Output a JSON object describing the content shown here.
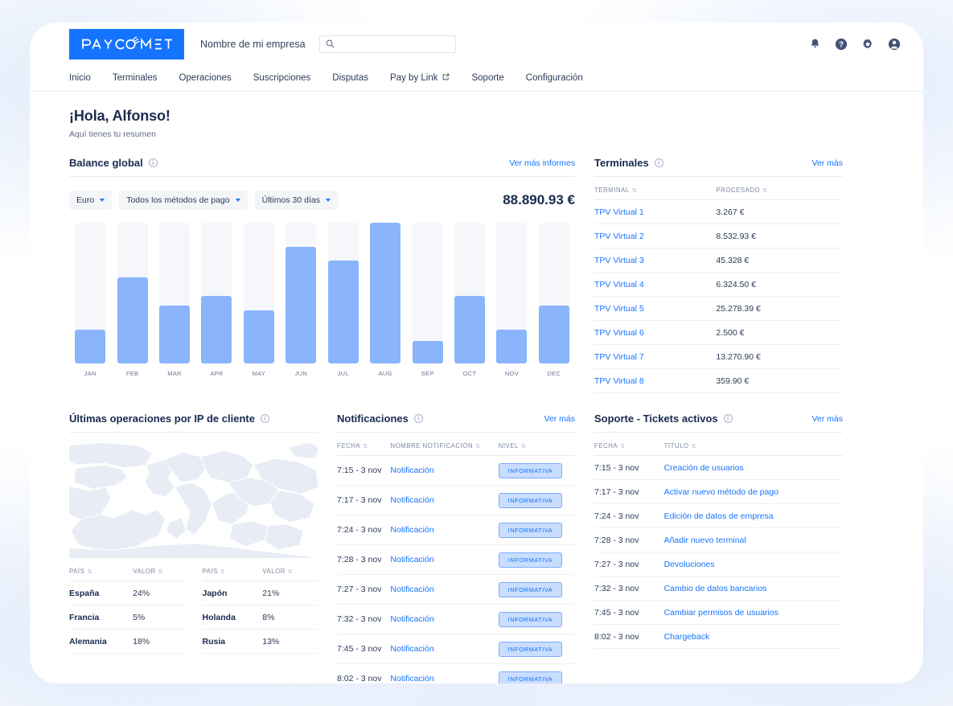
{
  "header": {
    "logo_text": "PAYCOMET",
    "company_name": "Nombre de mi empresa",
    "search_placeholder": "",
    "search_value": "",
    "icons": [
      "bell-icon",
      "help-icon",
      "gear-icon",
      "account-icon"
    ]
  },
  "nav": {
    "items": [
      {
        "label": "Inicio",
        "external": false
      },
      {
        "label": "Terminales",
        "external": false
      },
      {
        "label": "Operaciones",
        "external": false
      },
      {
        "label": "Suscripciones",
        "external": false
      },
      {
        "label": "Disputas",
        "external": false
      },
      {
        "label": "Pay by Link",
        "external": true
      },
      {
        "label": "Soporte",
        "external": false
      },
      {
        "label": "Configuración",
        "external": false
      }
    ]
  },
  "greeting": {
    "title": "¡Hola, Alfonso!",
    "subtitle": "Aquí tienes tu resumen"
  },
  "balance": {
    "title": "Balance global",
    "link": "Ver más informes",
    "filters": [
      {
        "label": "Euro"
      },
      {
        "label": "Todos los métodos de pago"
      },
      {
        "label": "Últimos 30 días"
      }
    ],
    "total": "88.890.93 €"
  },
  "chart_data": {
    "type": "bar",
    "title": "Balance global",
    "categories": [
      "JAN",
      "FEB",
      "MAR",
      "APR",
      "MAY",
      "JUN",
      "JUL",
      "AUG",
      "SEP",
      "OCT",
      "NOV",
      "DEC"
    ],
    "values": [
      24,
      61,
      41,
      48,
      38,
      83,
      73,
      100,
      16,
      48,
      24,
      41
    ],
    "xlabel": "",
    "ylabel": "",
    "ylim": [
      0,
      100
    ],
    "grid": false,
    "legend": "none",
    "bar_color": "#8ab4fc",
    "track_color": "#f5f7fa",
    "total_label": "88.890.93 €"
  },
  "terminals": {
    "title": "Terminales",
    "link": "Ver más",
    "columns": [
      "TERMINAL",
      "PROCESADO"
    ],
    "rows": [
      {
        "terminal": "TPV Virtual 1",
        "procesado": "3.267 €"
      },
      {
        "terminal": "TPV Virtual 2",
        "procesado": "8.532.93 €"
      },
      {
        "terminal": "TPV Virtual 3",
        "procesado": "45.328 €"
      },
      {
        "terminal": "TPV Virtual 4",
        "procesado": "6.324.50 €"
      },
      {
        "terminal": "TPV Virtual 5",
        "procesado": "25.278.39 €"
      },
      {
        "terminal": "TPV Virtual 6",
        "procesado": "2.500 €"
      },
      {
        "terminal": "TPV Virtual 7",
        "procesado": "13.270.90 €"
      },
      {
        "terminal": "TPV Virtual 8",
        "procesado": "359.90 €"
      }
    ]
  },
  "map_card": {
    "title": "Últimas operaciones por IP de cliente",
    "columns": [
      "PAÍS",
      "VALOR"
    ],
    "left_rows": [
      {
        "country": "España",
        "value": "24%"
      },
      {
        "country": "Francia",
        "value": "5%"
      },
      {
        "country": "Alemania",
        "value": "18%"
      }
    ],
    "right_rows": [
      {
        "country": "Japón",
        "value": "21%"
      },
      {
        "country": "Holanda",
        "value": "8%"
      },
      {
        "country": "Rusia",
        "value": "13%"
      }
    ]
  },
  "notifications": {
    "title": "Notificaciones",
    "link": "Ver más",
    "columns": [
      "FECHA",
      "NOMBRE NOTIFICACIÓN",
      "NIVEL"
    ],
    "rows": [
      {
        "fecha": "7:15 - 3 nov",
        "nombre": "Notificación",
        "nivel": "INFORMATIVA"
      },
      {
        "fecha": "7:17 - 3 nov",
        "nombre": "Notificación",
        "nivel": "INFORMATIVA"
      },
      {
        "fecha": "7:24 - 3 nov",
        "nombre": "Notificación",
        "nivel": "INFORMATIVA"
      },
      {
        "fecha": "7:28 - 3 nov",
        "nombre": "Notificación",
        "nivel": "INFORMATIVA"
      },
      {
        "fecha": "7:27 - 3 nov",
        "nombre": "Notificación",
        "nivel": "INFORMATIVA"
      },
      {
        "fecha": "7:32  - 3 nov",
        "nombre": "Notificación",
        "nivel": "INFORMATIVA"
      },
      {
        "fecha": "7:45 - 3 nov",
        "nombre": "Notificación",
        "nivel": "INFORMATIVA"
      },
      {
        "fecha": "8:02 - 3 nov",
        "nombre": "Notificación",
        "nivel": "INFORMATIVA"
      }
    ]
  },
  "tickets": {
    "title": "Soporte - Tickets activos",
    "link": "Ver más",
    "columns": [
      "FECHA",
      "TÍTULO"
    ],
    "rows": [
      {
        "fecha": "7:15 - 3 nov",
        "titulo": "Creación de usuarios"
      },
      {
        "fecha": "7:17 - 3 nov",
        "titulo": "Activar nuevo método de pago"
      },
      {
        "fecha": "7:24 - 3 nov",
        "titulo": "Edición de datos de empresa"
      },
      {
        "fecha": "7:28 - 3 nov",
        "titulo": "Añadir nuevo terminal"
      },
      {
        "fecha": "7:27 - 3 nov",
        "titulo": "Devoluciones"
      },
      {
        "fecha": "7:32 - 3 nov",
        "titulo": "Cambio de datos bancarios"
      },
      {
        "fecha": "7:45 - 3 nov",
        "titulo": "Cambiar permisos de usuarios"
      },
      {
        "fecha": "8:02 - 3 nov",
        "titulo": "Chargeback"
      }
    ]
  },
  "colors": {
    "brand_blue": "#1574ff",
    "bar_blue": "#8ab4fc",
    "dark_text": "#182a4e",
    "badge_bg": "#c9ddfe"
  }
}
